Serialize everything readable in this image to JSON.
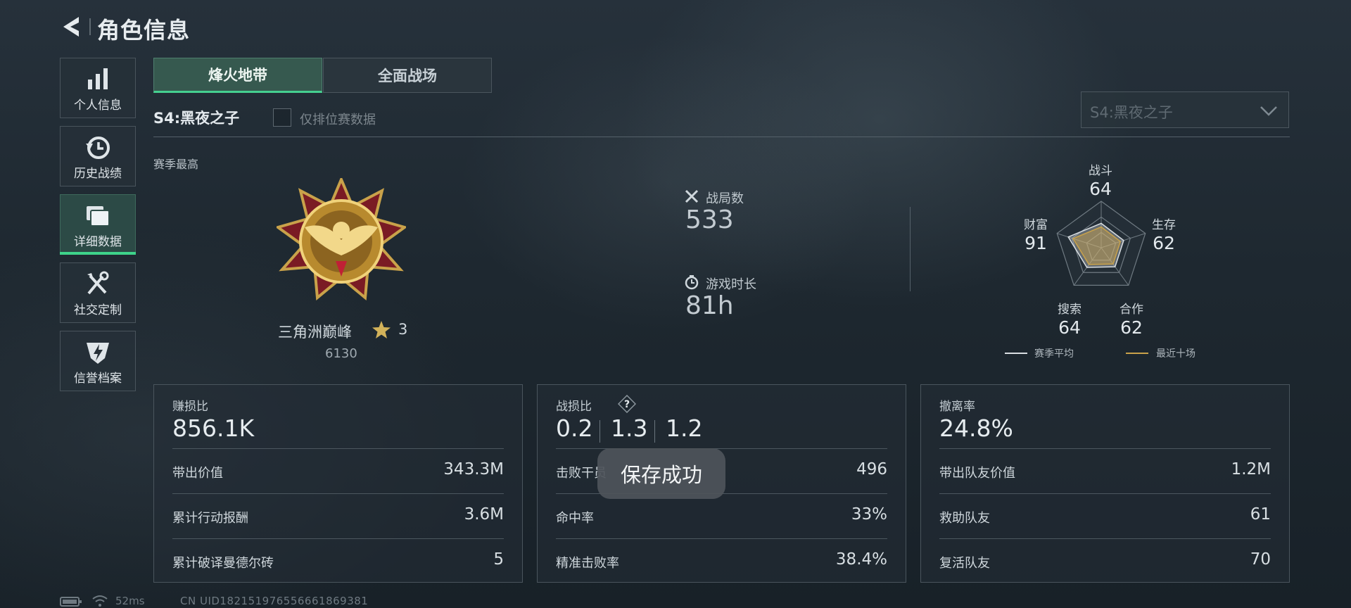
{
  "header": {
    "title": "角色信息"
  },
  "sidebar": {
    "items": [
      {
        "label": "个人信息",
        "icon": "bar-chart-icon"
      },
      {
        "label": "历史战绩",
        "icon": "history-clock-icon"
      },
      {
        "label": "详细数据",
        "icon": "cards-stack-icon",
        "active": true
      },
      {
        "label": "社交定制",
        "icon": "tools-icon"
      },
      {
        "label": "信誉档案",
        "icon": "shield-bolt-icon"
      }
    ]
  },
  "tabs": [
    {
      "label": "烽火地带",
      "active": true
    },
    {
      "label": "全面战场",
      "active": false
    }
  ],
  "season": {
    "title": "S4:黑夜之子",
    "ranked_only_label": "仅排位赛数据",
    "ranked_only_checked": false,
    "select_value": "S4:黑夜之子"
  },
  "rank": {
    "section_label": "赛季最高",
    "name": "三角洲巅峰",
    "stars": "3",
    "score": "6130"
  },
  "summary": {
    "matches_label": "战局数",
    "matches_value": "533",
    "time_label": "游戏时长",
    "time_value": "81h"
  },
  "radar": {
    "axes": [
      {
        "label": "战斗",
        "value": "64"
      },
      {
        "label": "生存",
        "value": "62"
      },
      {
        "label": "合作",
        "value": "62"
      },
      {
        "label": "搜索",
        "value": "64"
      },
      {
        "label": "财富",
        "value": "91"
      }
    ],
    "legend_season": "赛季平均",
    "legend_recent": "最近十场",
    "season_color": "#d9dee2",
    "recent_color": "#c9a24a"
  },
  "cards": {
    "profit": {
      "title": "赚损比",
      "value": "856.1K",
      "rows": [
        {
          "label": "带出价值",
          "value": "343.3M"
        },
        {
          "label": "累计行动报酬",
          "value": "3.6M"
        },
        {
          "label": "累计破译曼德尔砖",
          "value": "5"
        }
      ]
    },
    "kd": {
      "title": "战损比",
      "help": "?",
      "values": [
        "0.2",
        "1.3",
        "1.2"
      ],
      "rows": [
        {
          "label": "击败干员",
          "value": "496"
        },
        {
          "label": "命中率",
          "value": "33%"
        },
        {
          "label": "精准击败率",
          "value": "38.4%"
        }
      ]
    },
    "extract": {
      "title": "撤离率",
      "value": "24.8%",
      "rows": [
        {
          "label": "带出队友价值",
          "value": "1.2M"
        },
        {
          "label": "救助队友",
          "value": "61"
        },
        {
          "label": "复活队友",
          "value": "70"
        }
      ]
    }
  },
  "toast": {
    "text": "保存成功"
  },
  "status": {
    "ping": "52ms",
    "uid": "CN UID182151976556661869381"
  },
  "colors": {
    "accent": "#3ed38a",
    "gold": "#c9a24a"
  }
}
